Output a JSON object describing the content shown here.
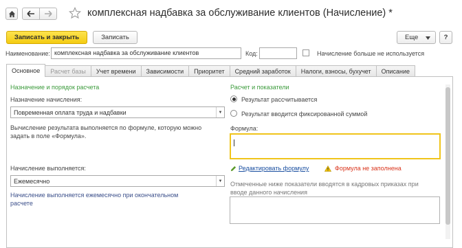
{
  "window": {
    "title": "комплексная надбавка за обслуживание клиентов (Начисление) *"
  },
  "icons": {
    "home": "home-icon",
    "back": "arrow-left-icon",
    "forward": "arrow-right-icon",
    "favorite": "star-icon",
    "pencil": "pencil-icon",
    "warning": "warning-icon"
  },
  "toolbar": {
    "save_close_label": "Записать и закрыть",
    "save_label": "Записать",
    "more_label": "Еще",
    "help_label": "?"
  },
  "fields": {
    "name_label": "Наименование:",
    "name_value": "комплексная надбавка за обслуживание клиентов",
    "code_label": "Код:",
    "code_value": "",
    "unused_label": "Начисление больше не используется",
    "unused_checked": false
  },
  "tabs": [
    {
      "label": "Основное",
      "active": true,
      "disabled": false
    },
    {
      "label": "Расчет базы",
      "active": false,
      "disabled": true
    },
    {
      "label": "Учет времени",
      "active": false,
      "disabled": false
    },
    {
      "label": "Зависимости",
      "active": false,
      "disabled": false
    },
    {
      "label": "Приоритет",
      "active": false,
      "disabled": false
    },
    {
      "label": "Средний заработок",
      "active": false,
      "disabled": false
    },
    {
      "label": "Налоги, взносы, бухучет",
      "active": false,
      "disabled": false
    },
    {
      "label": "Описание",
      "active": false,
      "disabled": false
    }
  ],
  "left": {
    "section_title": "Назначение и порядок расчета",
    "purpose_label": "Назначение начисления:",
    "purpose_value": "Повременная оплата труда и надбавки",
    "formula_hint": "Вычисление результата выполняется по формуле, которую можно задать в поле «Формула».",
    "period_label": "Начисление выполняется:",
    "period_value": "Ежемесячно",
    "period_note": "Начисление выполняется ежемесячно при окончательном расчете"
  },
  "right": {
    "section_title": "Расчет и показатели",
    "radio_calculated": "Результат рассчитывается",
    "radio_fixed": "Результат вводится фиксированной суммой",
    "radio_selected": "calculated",
    "formula_label": "Формула:",
    "formula_value": "",
    "edit_formula_link": "Редактировать формулу",
    "formula_warning": "Формула не заполнена",
    "indicators_note": "Отмеченные ниже показатели вводятся в кадровых приказах при вводе данного начисления"
  },
  "colors": {
    "accent_yellow": "#f4cc12",
    "section_green": "#3a9a3a",
    "link_blue": "#1a4fa0",
    "warning_red": "#d9331a",
    "note_blue": "#3b4f8a",
    "focus_border": "#f0c419"
  }
}
